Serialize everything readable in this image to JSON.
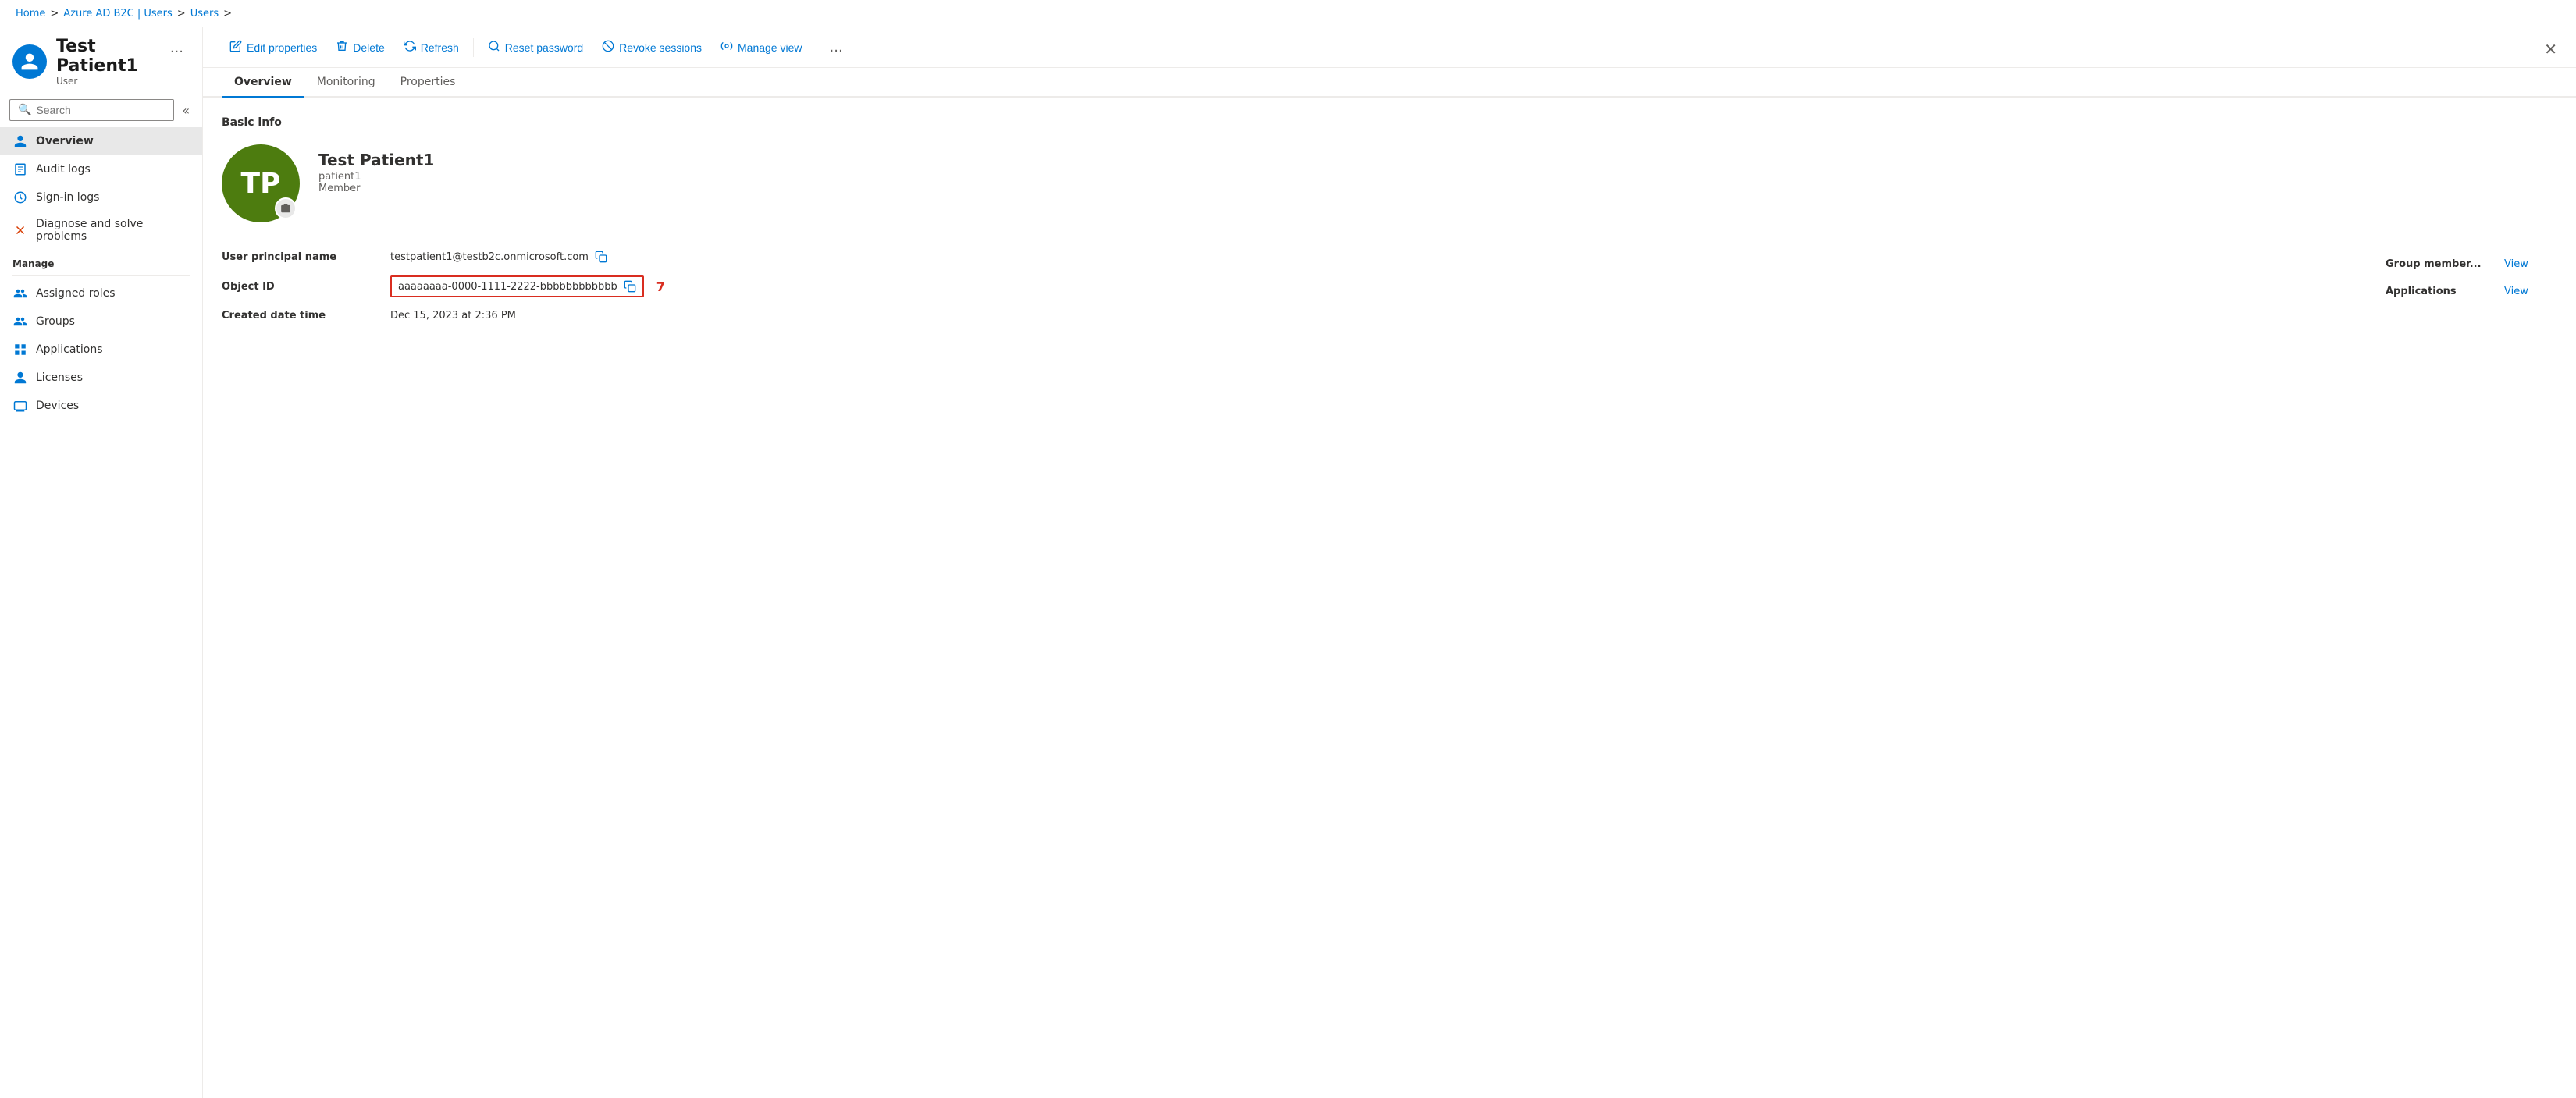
{
  "breadcrumb": {
    "items": [
      "Home",
      "Azure AD B2C | Users",
      "Users"
    ],
    "separator": ">"
  },
  "page_header": {
    "name": "Test Patient1",
    "subtitle": "User",
    "initials": "TP",
    "more_label": "..."
  },
  "sidebar": {
    "search_placeholder": "Search",
    "collapse_icon": "«",
    "nav_items": [
      {
        "id": "overview",
        "label": "Overview",
        "icon": "👤",
        "active": true
      },
      {
        "id": "audit-logs",
        "label": "Audit logs",
        "icon": "📋"
      },
      {
        "id": "sign-in-logs",
        "label": "Sign-in logs",
        "icon": "↻"
      },
      {
        "id": "diagnose",
        "label": "Diagnose and solve problems",
        "icon": "✕"
      }
    ],
    "manage_label": "Manage",
    "manage_items": [
      {
        "id": "assigned-roles",
        "label": "Assigned roles",
        "icon": "👥"
      },
      {
        "id": "groups",
        "label": "Groups",
        "icon": "👥"
      },
      {
        "id": "applications",
        "label": "Applications",
        "icon": "⚙"
      },
      {
        "id": "licenses",
        "label": "Licenses",
        "icon": "👤"
      },
      {
        "id": "devices",
        "label": "Devices",
        "icon": "💻"
      }
    ]
  },
  "toolbar": {
    "edit_label": "Edit properties",
    "delete_label": "Delete",
    "refresh_label": "Refresh",
    "reset_password_label": "Reset password",
    "revoke_sessions_label": "Revoke sessions",
    "manage_view_label": "Manage view",
    "more_label": "..."
  },
  "tabs": [
    {
      "id": "overview",
      "label": "Overview",
      "active": true
    },
    {
      "id": "monitoring",
      "label": "Monitoring"
    },
    {
      "id": "properties",
      "label": "Properties"
    }
  ],
  "content": {
    "basic_info_label": "Basic info",
    "user_avatar_initials": "TP",
    "user_name": "Test Patient1",
    "user_login": "patient1",
    "user_member": "Member",
    "fields": [
      {
        "label": "User principal name",
        "value": "testpatient1@testb2c.onmicrosoft.com",
        "copy": true,
        "highlighted": false
      },
      {
        "label": "Object ID",
        "value": "aaaaaaaa-0000-1111-2222-bbbbbbbbbbbb",
        "copy": true,
        "highlighted": true,
        "badge": "7"
      },
      {
        "label": "Created date time",
        "value": "Dec 15, 2023 at 2:36 PM",
        "copy": false,
        "highlighted": false
      }
    ],
    "right_fields": [
      {
        "label": "Group member...",
        "link_label": "View"
      },
      {
        "label": "Applications",
        "link_label": "View"
      }
    ]
  },
  "close_label": "✕"
}
